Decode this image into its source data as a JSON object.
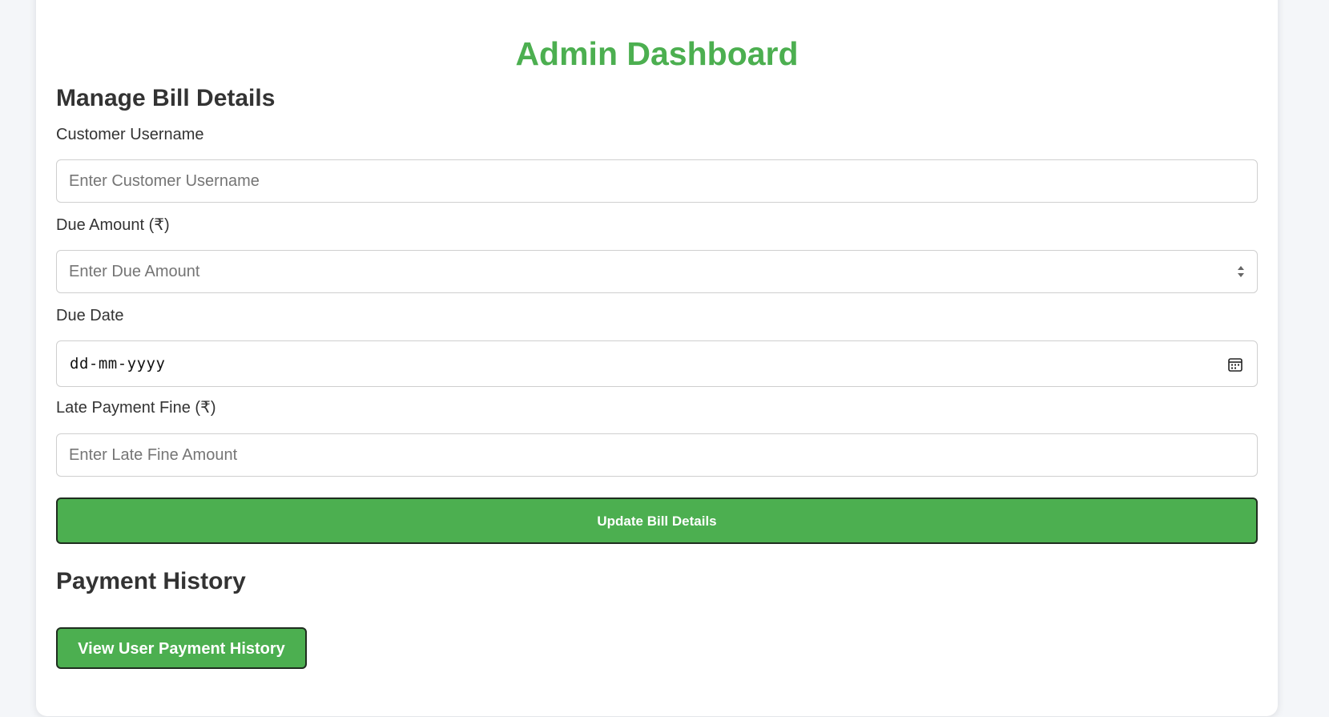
{
  "page": {
    "title": "Admin Dashboard"
  },
  "bill_section": {
    "heading": "Manage Bill Details",
    "username": {
      "label": "Customer Username",
      "placeholder": "Enter Customer Username"
    },
    "due_amount": {
      "label": "Due Amount (₹)",
      "placeholder": "Enter Due Amount"
    },
    "due_date": {
      "label": "Due Date",
      "display": "dd-mm-yyyy"
    },
    "late_fine": {
      "label": "Late Payment Fine (₹)",
      "placeholder": "Enter Late Fine Amount"
    },
    "submit_label": "Update Bill Details"
  },
  "history_section": {
    "heading": "Payment History",
    "button_label": "View User Payment History"
  },
  "icons": {
    "spinner": "number-spinner-icon",
    "calendar": "calendar-icon"
  },
  "colors": {
    "accent": "#4caf50",
    "background": "#f4f6f9",
    "text": "#333333"
  }
}
